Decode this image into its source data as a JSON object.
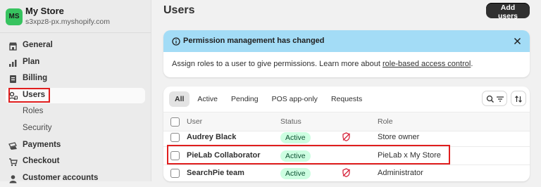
{
  "store": {
    "initials": "MS",
    "name": "My Store",
    "domain": "s3xpz8-px.myshopify.com",
    "avatar_color": "#37c35f"
  },
  "sidebar": {
    "items": [
      {
        "label": "General",
        "icon": "store-icon"
      },
      {
        "label": "Plan",
        "icon": "plan-chart-icon"
      },
      {
        "label": "Billing",
        "icon": "billing-receipt-icon"
      },
      {
        "label": "Users",
        "icon": "users-icon",
        "active": true
      },
      {
        "label": "Roles",
        "sub": true
      },
      {
        "label": "Security",
        "sub": true
      },
      {
        "label": "Payments",
        "icon": "payments-icon"
      },
      {
        "label": "Checkout",
        "icon": "cart-icon"
      },
      {
        "label": "Customer accounts",
        "icon": "person-icon"
      }
    ]
  },
  "page": {
    "title": "Users",
    "add_button": "Add users"
  },
  "banner": {
    "title": "Permission management has changed",
    "body_prefix": "Assign roles to a user to give permissions. Learn more about ",
    "link": "role-based access control",
    "body_suffix": ".",
    "color": "#a3dcf6"
  },
  "tabs": [
    "All",
    "Active",
    "Pending",
    "POS app-only",
    "Requests"
  ],
  "selected_tab": "All",
  "table": {
    "headers": {
      "user": "User",
      "status": "Status",
      "role": "Role"
    },
    "rows": [
      {
        "user": "Audrey Black",
        "status": "Active",
        "role": "Store owner",
        "shield": true
      },
      {
        "user": "PieLab Collaborator",
        "status": "Active",
        "role": "PieLab x My Store",
        "shield": false
      },
      {
        "user": "SearchPie team",
        "status": "Active",
        "role": "Administrator",
        "shield": true
      }
    ]
  },
  "colors": {
    "highlight": "#e01e1e",
    "badge_bg": "#cdfee1",
    "badge_text": "#0c5132",
    "shield": "#d7263d"
  }
}
